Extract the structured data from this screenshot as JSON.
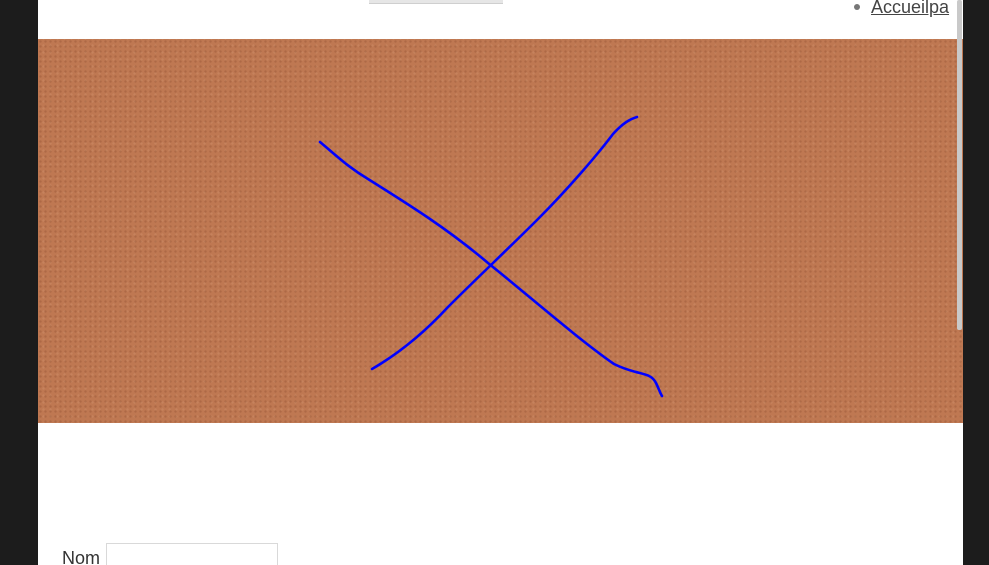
{
  "nav": {
    "items": [
      {
        "label": "Accueilpa"
      }
    ]
  },
  "canvas": {
    "stroke_color": "#0000ff",
    "background_color": "#bf7852"
  },
  "form": {
    "name_label": "Nom",
    "name_value": "",
    "name_placeholder": ""
  }
}
